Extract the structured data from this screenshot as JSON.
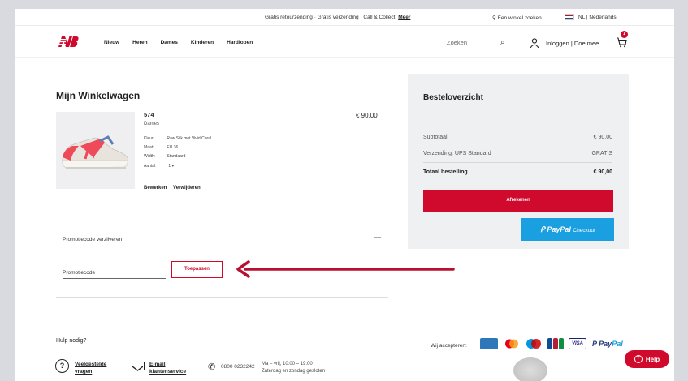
{
  "topbar": {
    "promo_text": "Gratis retourzending · Gratis verzending · Call & Collect",
    "promo_link": "Meer",
    "store_finder": "Een winkel zoeken",
    "language": "NL | Nederlands"
  },
  "header": {
    "nav": [
      "Nieuw",
      "Heren",
      "Dames",
      "Kinderen",
      "Hardlopen"
    ],
    "search_placeholder": "Zoeken",
    "login_text": "Inloggen | Doe mee",
    "cart_count": "1"
  },
  "cart": {
    "title": "Mijn Winkelwagen",
    "product": {
      "name": "574",
      "gender": "Dames",
      "price": "€ 90,00",
      "attributes": [
        {
          "label": "Kleur:",
          "value": "Raw Silk met Vivid Coral"
        },
        {
          "label": "Maat:",
          "value": "EU 36"
        },
        {
          "label": "Width:",
          "value": "Standaard"
        }
      ],
      "qty_label": "Aantal:",
      "qty_value": "1"
    },
    "edit_link": "Bewerken",
    "remove_link": "Verwijderen"
  },
  "promo": {
    "section_title": "Promotiecode verzilveren",
    "collapse_symbol": "—",
    "input_label": "Promotiecode",
    "apply_button": "Toepassen"
  },
  "summary": {
    "title": "Besteloverzicht",
    "subtotal_label": "Subtotaal",
    "subtotal_value": "€ 90,00",
    "shipping_label": "Verzending: UPS Standard",
    "shipping_value": "GRATIS",
    "total_label": "Totaal bestelling",
    "total_value": "€ 90,00",
    "checkout_button": "Afrekenen",
    "paypal_label": "PayPal",
    "paypal_checkout": "Checkout"
  },
  "footer": {
    "help_title": "Hulp nodig?",
    "faq_label_1": "Veelgestelde",
    "faq_label_2": "vragen",
    "email_label_1": "E-mail",
    "email_label_2": "klantenservice",
    "phone": "0800 0232242",
    "hours_1": "Ma – vrij, 10:00 – 19:00",
    "hours_2": "Zaterdag en zondag gesloten",
    "accept_label": "Wij accepteren:",
    "help_button": "Help"
  },
  "colors": {
    "brand_red": "#cf0a2c",
    "paypal_blue": "#1a9fe0",
    "summary_bg": "#eff0f2"
  },
  "icons": [
    "nb-logo",
    "location-icon",
    "nl-flag-icon",
    "search-icon",
    "user-icon",
    "cart-icon",
    "question-icon",
    "mail-icon",
    "phone-icon",
    "help-icon"
  ]
}
